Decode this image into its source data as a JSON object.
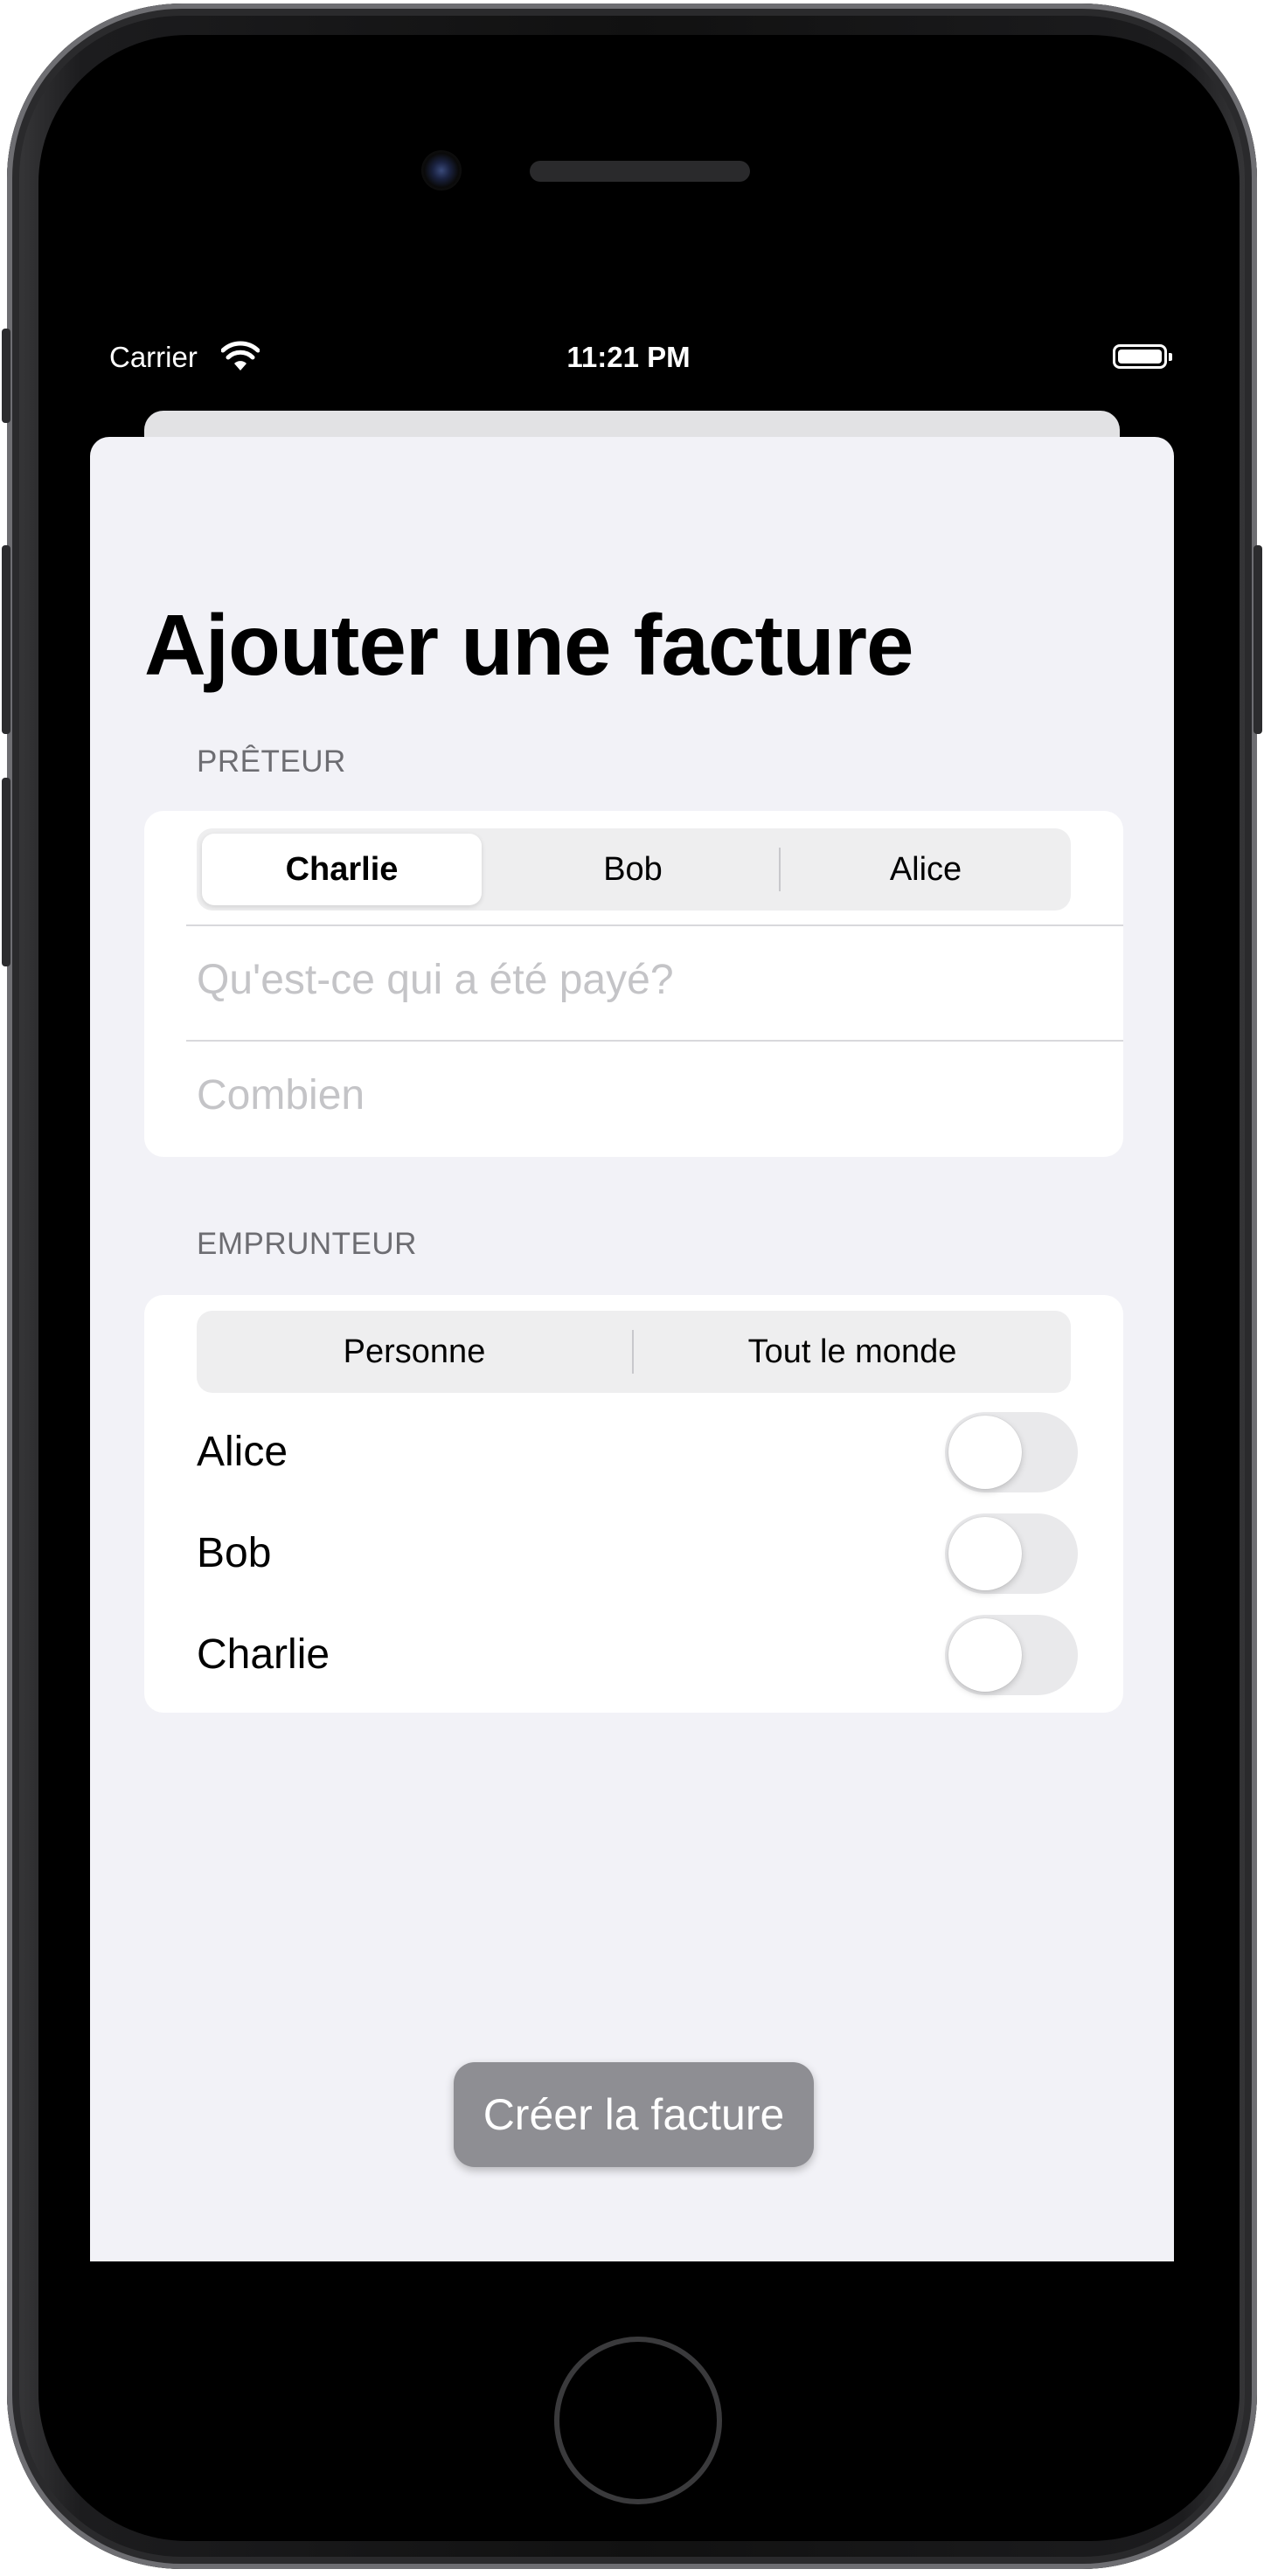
{
  "status_bar": {
    "carrier": "Carrier",
    "time": "11:21 PM"
  },
  "sheet": {
    "title": "Ajouter une facture",
    "lender_section": {
      "header": "PRÊTEUR",
      "segments": [
        "Charlie",
        "Bob",
        "Alice"
      ],
      "selected_segment": "Charlie",
      "what_placeholder": "Qu'est-ce qui a été payé?",
      "amount_placeholder": "Combien"
    },
    "borrower_section": {
      "header": "EMPRUNTEUR",
      "segments": [
        "Personne",
        "Tout le monde"
      ],
      "people": [
        {
          "name": "Alice",
          "enabled": false
        },
        {
          "name": "Bob",
          "enabled": false
        },
        {
          "name": "Charlie",
          "enabled": false
        }
      ]
    },
    "create_button": "Créer la facture"
  },
  "colors": {
    "sheet_background": "#f2f2f7",
    "button_disabled": "#8e8e93",
    "placeholder": "#c4c4c7",
    "section_header": "#6d6d72"
  }
}
